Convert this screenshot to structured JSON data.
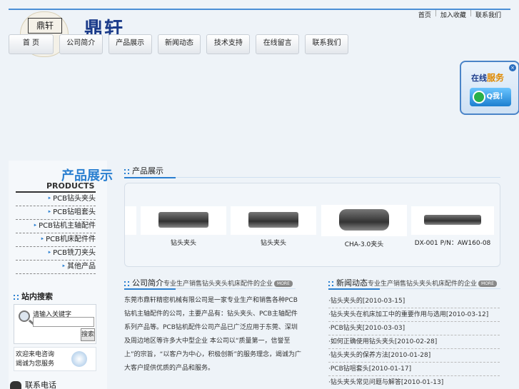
{
  "top_links": [
    "首页",
    "加入收藏",
    "联系我们"
  ],
  "brand": "鼎轩",
  "logo_text": "鼎轩",
  "nav": [
    "首 页",
    "公司简介",
    "产品展示",
    "新闻动态",
    "技术支持",
    "在线留言",
    "联系我们"
  ],
  "qq_widget": {
    "title_a": "在线",
    "title_b": "服务",
    "button": "Q我！",
    "close": "×"
  },
  "sidebar": {
    "title_cn": "产品展示",
    "title_en": "PRODUCTS",
    "categories": [
      "PCB钻头夹头",
      "PCB钻咀套头",
      "PCB钻机主轴配件",
      "PCB机床配件件",
      "PCB铣刀夹头",
      "其他产品"
    ]
  },
  "search": {
    "title": "站内搜索",
    "label": "请输入关键字",
    "button": "搜索",
    "placeholder": ""
  },
  "contact": {
    "line1": "欢迎来电咨询",
    "line2": "竭诚为您服务",
    "phone_title": "联系电话"
  },
  "showcase": {
    "title": "产品展示",
    "products": [
      "钻头夹头",
      "钻头夹头",
      "CHA-3.0夹头",
      "DX-001 P/N：AW160-08"
    ]
  },
  "about": {
    "title": "公司简介",
    "subtitle": "专业生产销售钻头夹头机床配件的企业",
    "more": "MORE",
    "text": "东莞市鼎轩精密机械有限公司是一家专业生产和销售各种PCB钻机主轴配件的公司，主要产品有：钻头夹头、PCB主轴配件系列产品等。PCB钻机配件公司产品已广泛应用于东莞、深圳及周边地区等许多大中型企业 本公司以“质量第一，信誉至上”的宗旨，“以客户为中心，积极创新”的服务理念，竭诚为广大客户提供优质的产品和服务。"
  },
  "news": {
    "title": "新闻动态",
    "subtitle": "专业生产销售钻头夹头机床配件的企业",
    "more": "MORE",
    "items": [
      {
        "text": "·钻头夹头的",
        "date": "[2010-03-15]"
      },
      {
        "text": "·钻头夹头在机床加工中的重要作用与选用",
        "date": "[2010-03-12]"
      },
      {
        "text": "·PCB钻头夹",
        "date": "[2010-03-03]"
      },
      {
        "text": "·如何正确使用钻头夹头",
        "date": "[2010-02-28]"
      },
      {
        "text": "·钻头夹头的保养方法",
        "date": "[2010-01-28]"
      },
      {
        "text": "·PCB钻咀套头",
        "date": "[2010-01-17]"
      },
      {
        "text": "·钻头夹头常见问题与解答",
        "date": "[2010-01-13]"
      }
    ]
  }
}
